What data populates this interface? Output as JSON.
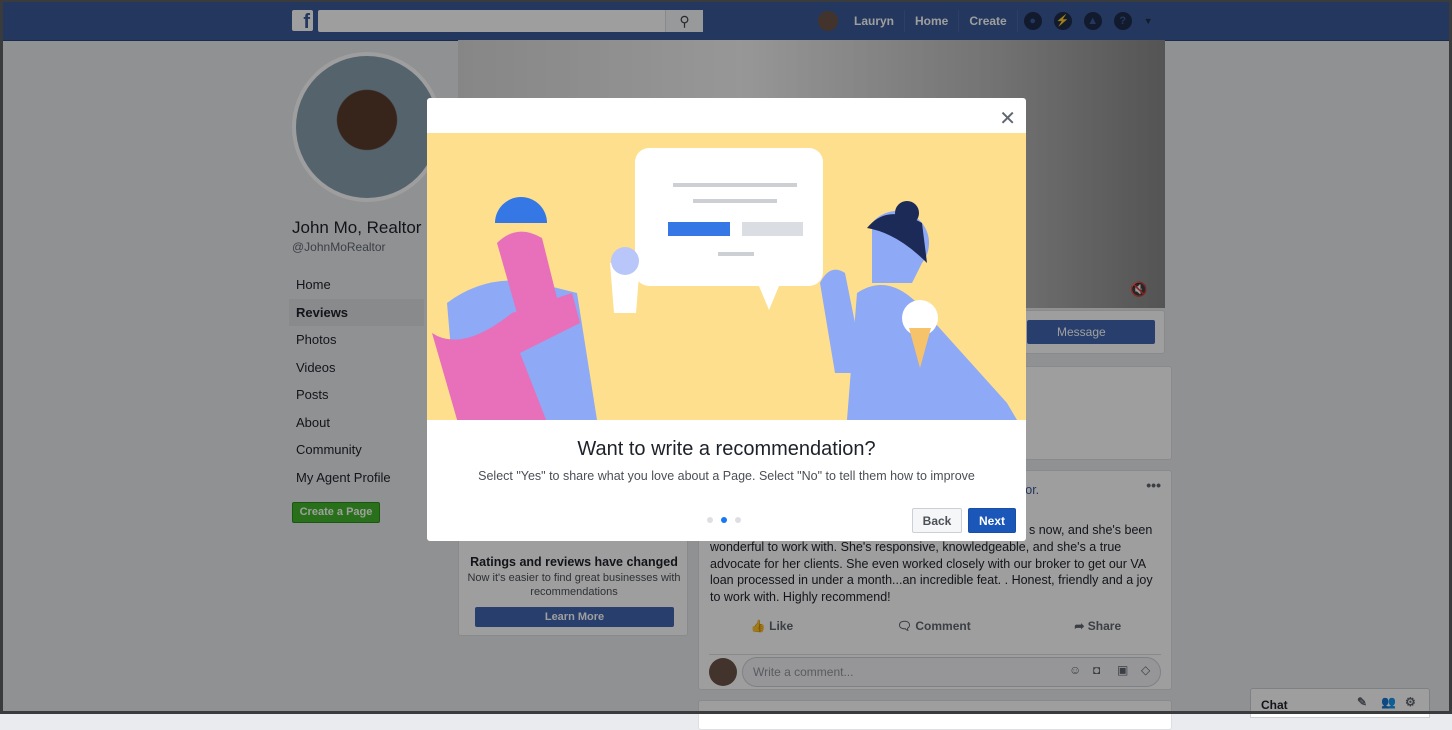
{
  "topbar": {
    "user": "Lauryn",
    "home": "Home",
    "create": "Create",
    "search_placeholder": ""
  },
  "profile": {
    "name": "John Mo, Realtor",
    "handle": "@JohnMoRealtor"
  },
  "sidebar": {
    "items": [
      {
        "label": "Home"
      },
      {
        "label": "Reviews",
        "active": true
      },
      {
        "label": "Photos"
      },
      {
        "label": "Videos"
      },
      {
        "label": "Posts"
      },
      {
        "label": "About"
      },
      {
        "label": "Community"
      },
      {
        "label": "My Agent Profile"
      }
    ],
    "create_page": "Create a Page"
  },
  "cover": {
    "message_button": "Message"
  },
  "post": {
    "author_fragment": "ltor.",
    "text_fragment": "s now, and she's been",
    "text": "wonderful to work with. She's responsive, knowledgeable, and she's a true advocate for her clients. She even worked closely with our broker to get our VA loan processed in under a month...an incredible feat. .       Honest, friendly and a joy to work with. Highly recommend!",
    "like": "Like",
    "comment": "Comment",
    "share": "Share",
    "comment_placeholder": "Write a comment..."
  },
  "ratings": {
    "title": "Ratings and reviews have changed",
    "subtitle": "Now it's easier to find great businesses with recommendations",
    "button": "Learn More"
  },
  "chat": {
    "label": "Chat"
  },
  "modal": {
    "title": "Want to write a recommendation?",
    "subtitle": "Select \"Yes\" to share what you love about a Page. Select \"No\" to tell them how to improve",
    "back": "Back",
    "next": "Next",
    "step": 2,
    "total_steps": 3,
    "colors": {
      "illustration_bg": "#fddf8e",
      "primary": "#1a57b8"
    }
  }
}
